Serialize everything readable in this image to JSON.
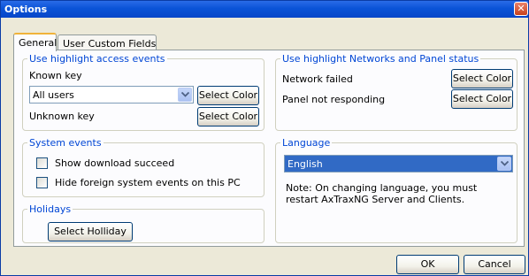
{
  "window": {
    "title": "Options",
    "close_glyph": "✕"
  },
  "tabs": [
    {
      "label": "General",
      "active": true
    },
    {
      "label": "User Custom Fields",
      "active": false
    }
  ],
  "access_events": {
    "legend": "Use highlight access events",
    "known_key_label": "Known key",
    "known_key_select_value": "All users",
    "select_color_label": "Select Color",
    "unknown_key_label": "Unknown key",
    "unknown_select_color_label": "Select Color"
  },
  "network_status": {
    "legend": "Use highlight Networks and Panel status",
    "network_failed_label": "Network failed",
    "network_select_color_label": "Select Color",
    "panel_not_responding_label": "Panel not responding",
    "panel_select_color_label": "Select Color"
  },
  "system_events": {
    "legend": "System events",
    "show_download_label": "Show download succeed",
    "show_download_checked": false,
    "hide_foreign_label": "Hide foreign system events on this PC",
    "hide_foreign_checked": false
  },
  "language": {
    "legend": "Language",
    "selected": "English",
    "note": "Note: On changing language, you  must restart AxTraxNG Server and Clients."
  },
  "holidays": {
    "legend": "Holidays",
    "select_holiday_label": "Select Holliday"
  },
  "footer": {
    "ok_label": "OK",
    "cancel_label": "Cancel"
  },
  "colors": {
    "title_bar": "#0a53d7",
    "legend_text": "#0046d5",
    "selection": "#316ac5",
    "dialog_bg": "#ece9d8"
  }
}
